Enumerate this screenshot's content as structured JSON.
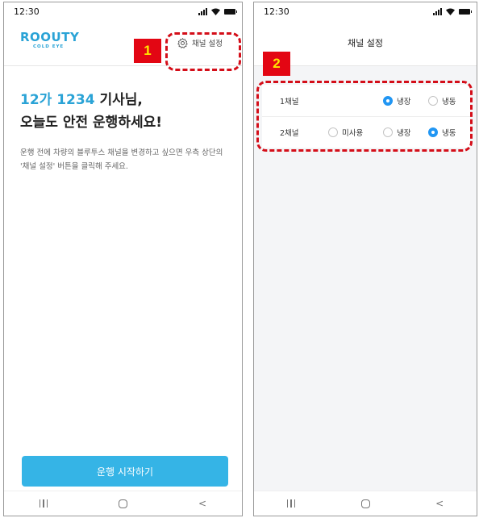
{
  "left_screen": {
    "status": {
      "time": "12:30"
    },
    "header": {
      "logo_main": "ROOUTY",
      "logo_sub": "COLD EYE",
      "settings_label": "채널 설정"
    },
    "greeting": {
      "plate": "12가 1234",
      "suffix": " 기사님,",
      "line2": "오늘도 안전 운행하세요!"
    },
    "guide_text": "운행 전에 차량의 블루투스 채널을 변경하고 싶으면 우측 상단의 '채널 설정' 버튼을 클릭해 주세요.",
    "start_button": "운행 시작하기",
    "nav": {
      "recent": "|||",
      "home": "○",
      "back": "<"
    }
  },
  "right_screen": {
    "status": {
      "time": "12:30"
    },
    "title": "채널 설정",
    "channels": [
      {
        "label": "1채널",
        "options": [
          {
            "label": "냉장",
            "selected": true
          },
          {
            "label": "냉동",
            "selected": false
          }
        ]
      },
      {
        "label": "2채널",
        "options": [
          {
            "label": "미사용",
            "selected": false
          },
          {
            "label": "냉장",
            "selected": false
          },
          {
            "label": "냉동",
            "selected": true
          }
        ]
      }
    ]
  },
  "callouts": {
    "first": "1",
    "second": "2"
  },
  "colors": {
    "accent": "#2aa3d6",
    "button": "#35b4e6",
    "radio_on": "#2196f3",
    "callout_bg": "#e30613",
    "callout_text": "#ffe600",
    "dash": "#d40e19"
  }
}
